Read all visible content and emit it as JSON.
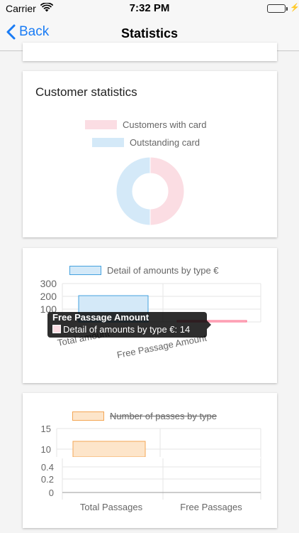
{
  "status_bar": {
    "carrier": "Carrier",
    "time": "7:32 PM"
  },
  "nav": {
    "back_label": "Back",
    "title": "Statistics"
  },
  "colors": {
    "accent": "#1a7cf5",
    "pink": "#fbdde3",
    "blue": "#d4e9f8",
    "blue_border": "#45a2df",
    "orange": "#fde5ca",
    "orange_border": "#f4a655"
  },
  "customer_card": {
    "title": "Customer statistics",
    "legend": [
      "Customers with card",
      "Outstanding card"
    ]
  },
  "amounts_card": {
    "legend": "Detail of amounts by type €",
    "tooltip": {
      "title": "Free Passage Amount",
      "text": "Detail of amounts by type €: 14"
    }
  },
  "passes_card": {
    "legend": "Number of passes by type"
  },
  "chart_data": [
    {
      "type": "pie",
      "labels": [
        "Customers with card",
        "Outstanding card"
      ],
      "values": [
        50,
        50
      ],
      "colors": [
        "#fbdde3",
        "#d4e9f8"
      ]
    },
    {
      "type": "bar",
      "categories": [
        "Total amount",
        "Free Passage Amount"
      ],
      "series": [
        {
          "name": "Detail of amounts by type €",
          "values": [
            200,
            14
          ]
        }
      ],
      "yticks": [
        "300",
        "200",
        "100"
      ],
      "ylim": [
        0,
        300
      ],
      "grid": true
    },
    {
      "type": "bar",
      "categories": [
        "Total Passages",
        "Free Passages"
      ],
      "series": [
        {
          "name": "Number of passes by type",
          "values": [
            12,
            0
          ]
        }
      ],
      "yticks_upper": [
        "15",
        "10"
      ],
      "yticks_lower": [
        "0.4",
        "0.2",
        "0"
      ],
      "grid": true
    }
  ]
}
